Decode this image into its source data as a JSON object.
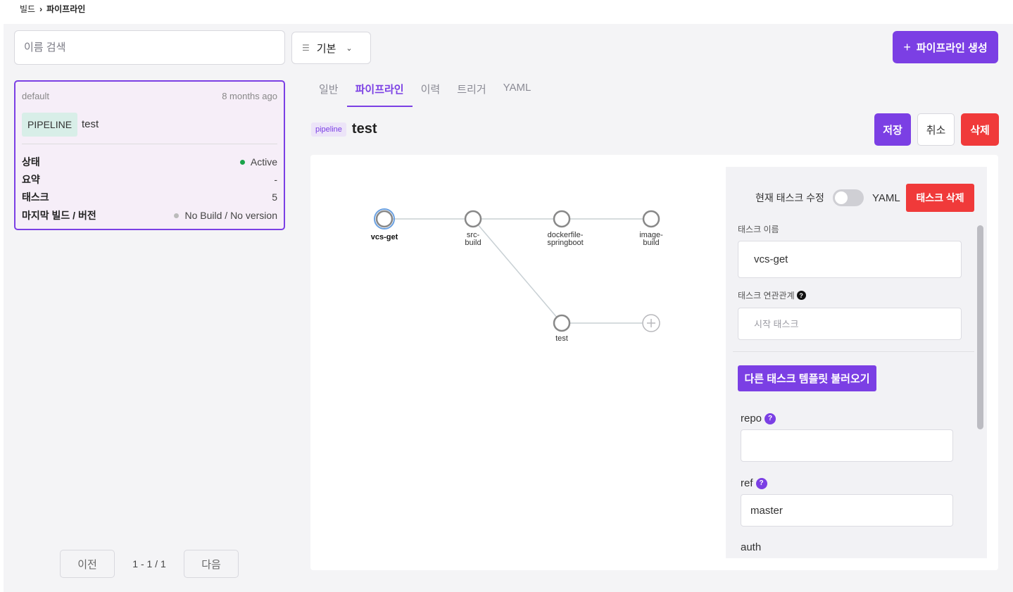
{
  "breadcrumb": {
    "parent": "빌드",
    "separator": "›",
    "current": "파이프라인"
  },
  "toolbar": {
    "search_placeholder": "이름 검색",
    "filter_label": "기본",
    "create_label": "파이프라인 생성"
  },
  "card": {
    "namespace": "default",
    "age": "8 months ago",
    "badge": "PIPELINE",
    "name": "test",
    "rows": [
      {
        "key": "상태",
        "value": "Active",
        "status": "active"
      },
      {
        "key": "요약",
        "value": "-"
      },
      {
        "key": "태스크",
        "value": "5"
      },
      {
        "key": "마지막 빌드 / 버전",
        "value": "No Build / No version",
        "status": "none"
      }
    ]
  },
  "pager": {
    "prev": "이전",
    "info": "1 - 1 / 1",
    "next": "다음"
  },
  "tabs": [
    "일반",
    "파이프라인",
    "이력",
    "트리거",
    "YAML"
  ],
  "active_tab": "파이프라인",
  "pipeline": {
    "tag": "pipeline",
    "title": "test"
  },
  "actions": {
    "save": "저장",
    "cancel": "취소",
    "delete": "삭제"
  },
  "graph": {
    "nodes": [
      {
        "id": "vcs-get",
        "label": "vcs-get",
        "selected": true
      },
      {
        "id": "src-build",
        "label": "src-\nbuild"
      },
      {
        "id": "dockerfile-springboot",
        "label": "dockerfile-\nspringboot"
      },
      {
        "id": "image-build",
        "label": "image-\nbuild"
      },
      {
        "id": "test",
        "label": "test"
      }
    ],
    "edges": [
      [
        "vcs-get",
        "src-build"
      ],
      [
        "src-build",
        "dockerfile-springboot"
      ],
      [
        "dockerfile-springboot",
        "image-build"
      ],
      [
        "src-build",
        "test"
      ]
    ]
  },
  "panel": {
    "edit_label": "현재 태스크 수정",
    "yaml_label": "YAML",
    "task_delete": "태스크 삭제",
    "task_name_label": "태스크 이름",
    "task_name_value": "vcs-get",
    "relation_label": "태스크 연관관계",
    "relation_placeholder": "시작 태스크",
    "template_button": "다른 태스크 템플릿 불러오기",
    "fields": [
      {
        "label": "repo",
        "value": ""
      },
      {
        "label": "ref",
        "value": "master"
      },
      {
        "label": "auth"
      }
    ]
  },
  "colors": {
    "accent": "#7b3fe4",
    "danger": "#f03a3a",
    "active": "#1aa34a"
  }
}
